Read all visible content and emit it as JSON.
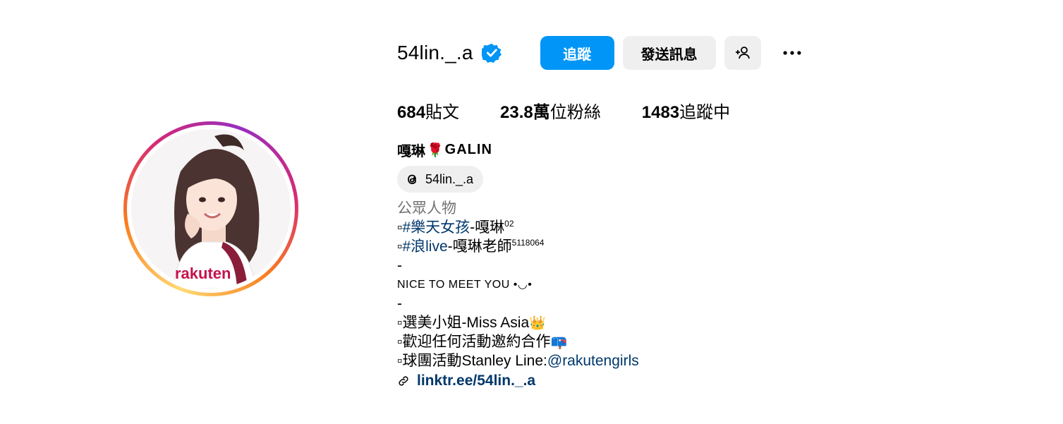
{
  "profile": {
    "username": "54lin._.a",
    "follow_label": "追蹤",
    "message_label": "發送訊息",
    "stats": {
      "posts_value": "684",
      "posts_label": "貼文",
      "followers_value": "23.8萬",
      "followers_label": "位粉絲",
      "following_value": "1483",
      "following_label": "追蹤中"
    },
    "full_name": "嘎琳",
    "full_name_suffix": "GALIN",
    "full_name_emoji": "🌹",
    "threads_handle": "54lin._.a",
    "category": "公眾人物",
    "bio": {
      "line1_prefix": "▫",
      "line1_tag": "#樂天女孩",
      "line1_rest": "-嘎琳",
      "line1_sup": "02",
      "line2_prefix": "▫",
      "line2_tag": "#浪live",
      "line2_rest": "-嘎琳老師",
      "line2_sup": "5118064",
      "line3": "-",
      "line4": "NICE TO MEET YOU •◡•",
      "line5": "-",
      "line6": "▫選美小姐-Miss Asia",
      "line6_emoji": "👑",
      "line7": "▫歡迎任何活動邀約合作",
      "line7_emoji": "📪",
      "line8_prefix": "▫球團活動Stanley Line:",
      "line8_mention": "@rakutengirls"
    },
    "link": "linktr.ee/54lin._.a"
  },
  "icons": {
    "verified": "verified-badge-icon",
    "add_user": "add-user-icon",
    "more": "more-options-icon",
    "threads": "threads-icon",
    "link": "link-icon"
  },
  "colors": {
    "primary_button": "#0095f6",
    "secondary_button": "#efefef",
    "link_text": "#00376b",
    "muted_text": "#737373"
  }
}
